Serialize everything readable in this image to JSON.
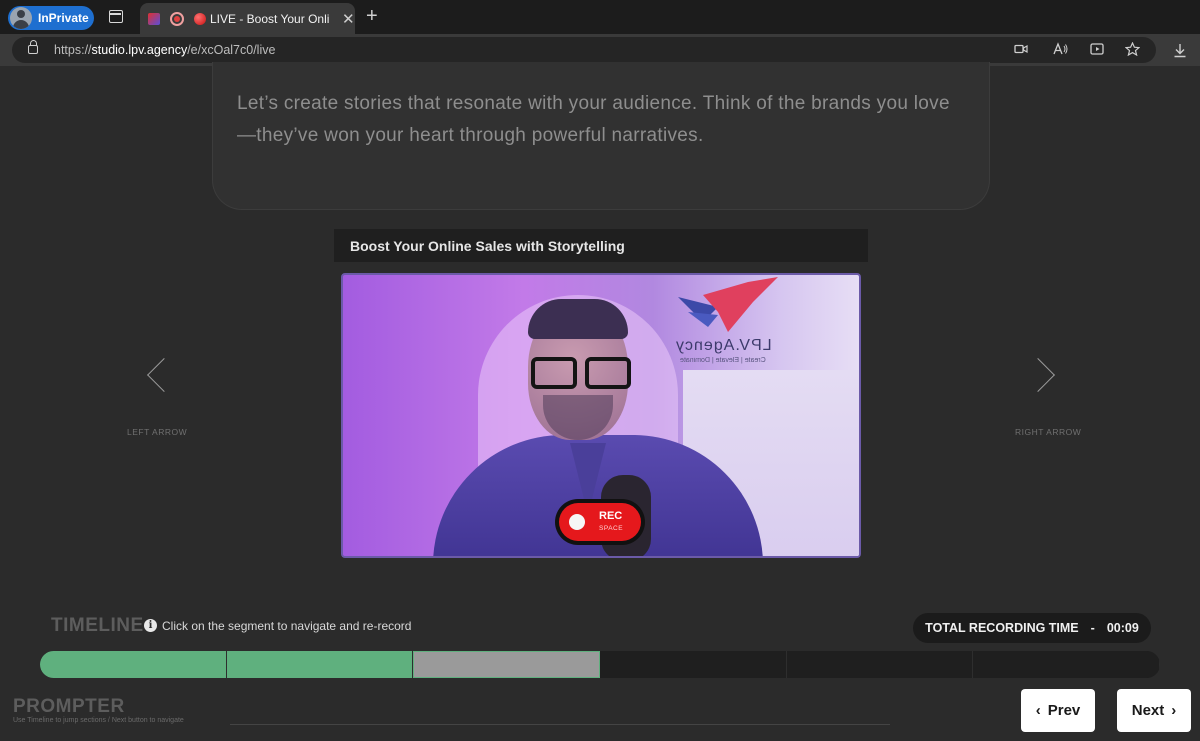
{
  "browser": {
    "profile_label": "InPrivate",
    "tab_title": "LIVE - Boost Your Online Sales with Storytelling",
    "close_glyph": "✕",
    "new_tab_glyph": "+",
    "url_prefix": "https://",
    "url_host": "studio.lpv.agency",
    "url_path": "/e/xcOal7c0/live",
    "toolbar_icons": [
      "camera-icon",
      "read-aloud-icon",
      "immersive-reader-icon",
      "favorite-star-icon",
      "download-icon"
    ]
  },
  "prompter": {
    "script_text": "Let’s create stories that resonate with your audience. Think of the brands you love—they’ve won your heart through powerful narratives."
  },
  "video": {
    "title": "Boost Your Online Sales with Storytelling",
    "brand_text": "LPV.Agency",
    "brand_sub": "Create | Elevate | Dominate",
    "rec_label": "REC",
    "rec_hint": "SPACE"
  },
  "navigation": {
    "left_arrow_label": "LEFT ARROW",
    "right_arrow_label": "RIGHT ARROW"
  },
  "timeline": {
    "title": "TIMELINE",
    "hint": "Click on the segment to navigate and re-record",
    "total_label": "TOTAL RECORDING TIME",
    "total_sep": "-",
    "total_value": "00:09",
    "segments": [
      {
        "state": "recorded",
        "color": "#5fb07e"
      },
      {
        "state": "recorded",
        "color": "#5fb07e"
      },
      {
        "state": "current",
        "color": "#9a9a9a"
      },
      {
        "state": "empty",
        "color": "#1f1f1f"
      },
      {
        "state": "empty",
        "color": "#1f1f1f"
      },
      {
        "state": "empty",
        "color": "#1f1f1f"
      }
    ]
  },
  "footer": {
    "title": "PROMPTER",
    "subtitle": "Use Timeline to jump sections / Next button to navigate",
    "prev_label": "Prev",
    "next_label": "Next"
  },
  "colors": {
    "accent_green": "#5fb07e",
    "rec_red": "#e5181c",
    "inprivate_blue": "#1e6fd0"
  }
}
